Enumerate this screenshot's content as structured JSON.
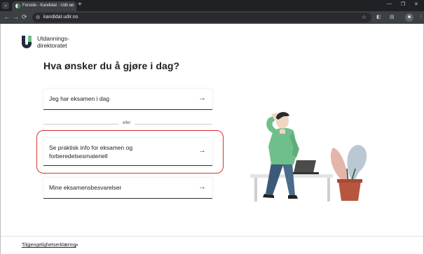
{
  "browser": {
    "tab_menu_glyph": "⌄",
    "tab_title": "Forside - Kandidat - Udir.no",
    "tab_close": "✕",
    "new_tab": "+",
    "window_controls": [
      "—",
      "❐",
      "✕"
    ],
    "back": "←",
    "forward": "→",
    "reload": "⟳",
    "url": "kandidat.udir.no",
    "star": "☆",
    "extension_icons": [
      "extensions-icon",
      "sidepanel-icon",
      "profile-icon",
      "menu-icon"
    ],
    "menu_glyph": "⋮"
  },
  "logo": {
    "line1": "Utdannings-",
    "line2": "direktoratet",
    "color": "#1f2c3a"
  },
  "heading": "Hva ønsker du å gjøre i dag?",
  "options": [
    {
      "label": "Jeg har eksamen i dag",
      "arrow": "→"
    },
    {
      "label_line1": "Se praktisk info for eksamen og",
      "label_line2": "forberedelsesmateriell",
      "arrow": "→"
    },
    {
      "label": "Mine eksamensbesvarelser",
      "arrow": "→"
    }
  ],
  "divider_text": "eller",
  "footer": {
    "link": "Tilgjengelighetserklæring",
    "ext_icon": "↗"
  },
  "colors": {
    "highlight": "#d9312f",
    "shirt": "#6fbf8a",
    "pants": "#4a6b8a",
    "plant_pot": "#b8553f"
  }
}
